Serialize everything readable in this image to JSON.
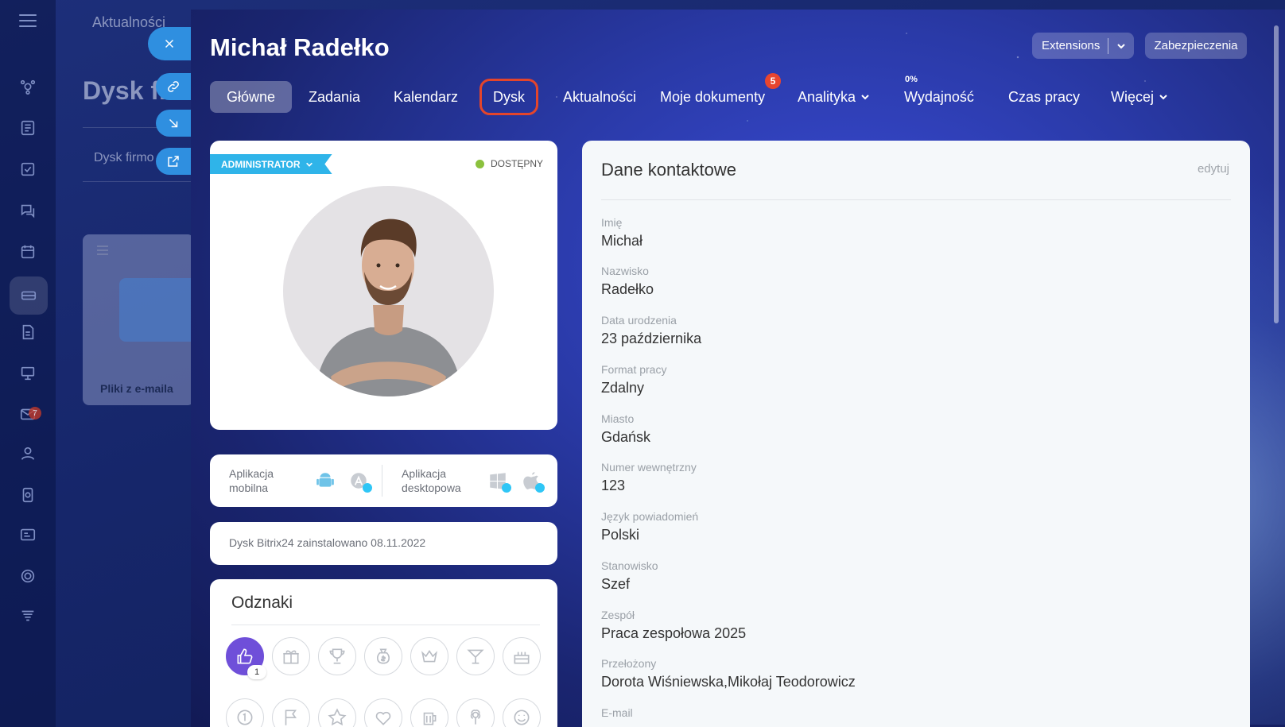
{
  "background": {
    "top_nav": "Aktualności",
    "page_title": "Dysk fi",
    "subnav": "Dysk firmo",
    "folder_label": "Pliki z e-maila",
    "mail_badge": "7"
  },
  "panel": {
    "title": "Michał Radełko",
    "extensions_label": "Extensions",
    "security_label": "Zabezpieczenia",
    "tabs": [
      {
        "label": "Główne"
      },
      {
        "label": "Zadania"
      },
      {
        "label": "Kalendarz"
      },
      {
        "label": "Dysk"
      },
      {
        "label": "Aktualności"
      },
      {
        "label": "Moje dokumenty",
        "badge": "5"
      },
      {
        "label": "Analityka"
      },
      {
        "label": "Wydajność",
        "percent": "0%"
      },
      {
        "label": "Czas pracy"
      },
      {
        "label": "Więcej"
      }
    ]
  },
  "profile": {
    "role": "ADMINISTRATOR",
    "status": "DOSTĘPNY"
  },
  "apps": {
    "mobile": "Aplikacja mobilna",
    "desktop": "Aplikacja desktopowa"
  },
  "disk_info": "Dysk Bitrix24 zainstalowano 08.11.2022",
  "badges": {
    "title": "Odznaki",
    "first_count": "1"
  },
  "contact": {
    "title": "Dane kontaktowe",
    "edit": "edytuj",
    "fields": [
      {
        "label": "Imię",
        "value": "Michał"
      },
      {
        "label": "Nazwisko",
        "value": "Radełko"
      },
      {
        "label": "Data urodzenia",
        "value": "23 października"
      },
      {
        "label": "Format pracy",
        "value": "Zdalny"
      },
      {
        "label": "Miasto",
        "value": "Gdańsk"
      },
      {
        "label": "Numer wewnętrzny",
        "value": "123"
      },
      {
        "label": "Język powiadomień",
        "value": "Polski"
      },
      {
        "label": "Stanowisko",
        "value": "Szef"
      },
      {
        "label": "Zespół",
        "value": "Praca zespołowa 2025"
      },
      {
        "label": "Przełożony",
        "value": "Dorota Wiśniewska,Mikołaj Teodorowicz"
      },
      {
        "label": "E-mail",
        "value": ""
      }
    ]
  },
  "colors": {
    "accent_tab_outline": "#e4452b",
    "admin_tag": "#2fb4e9",
    "status_online": "#8bc13d",
    "badge_active": "#6f4fd9"
  }
}
